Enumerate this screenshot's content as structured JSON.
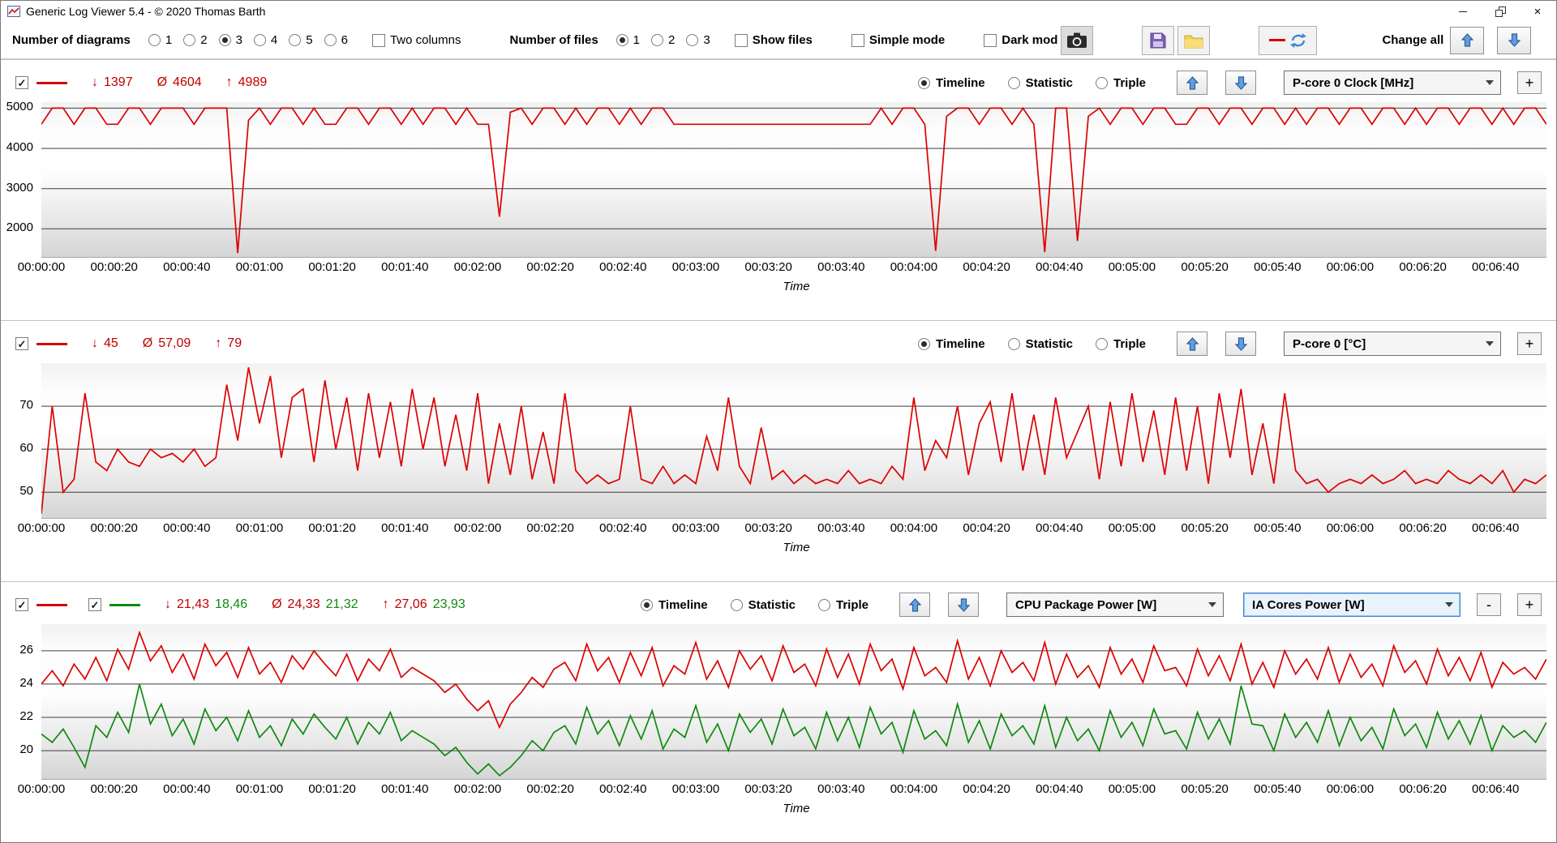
{
  "titlebar": {
    "title": "Generic Log Viewer 5.4 - © 2020 Thomas Barth",
    "close_glyph": "×"
  },
  "toolbar": {
    "diagrams_label": "Number of diagrams",
    "diagram_options": [
      "1",
      "2",
      "3",
      "4",
      "5",
      "6"
    ],
    "diagrams_selected": "3",
    "two_columns_label": "Two columns",
    "files_label": "Number of files",
    "file_options": [
      "1",
      "2",
      "3"
    ],
    "files_selected": "1",
    "show_files_label": "Show files",
    "simple_mode_label": "Simple mode",
    "dark_mode_label": "Dark mod",
    "change_all_label": "Change all"
  },
  "symbols": {
    "min": "↓",
    "avg": "Ø",
    "max": "↑"
  },
  "colors": {
    "series_red": "#dd0000",
    "series_green": "#0f8a0f",
    "stat_red": "#c00000",
    "stat_green": "#0f8a0f",
    "arrow_blue": "#5f9fe0"
  },
  "panels": [
    {
      "toggles": [
        {
          "color": "#d40000",
          "checked": true
        }
      ],
      "stats": {
        "min": [
          "1397"
        ],
        "avg": [
          "4604"
        ],
        "max": [
          "4989"
        ]
      },
      "view_options": [
        "Timeline",
        "Statistic",
        "Triple"
      ],
      "view_selected": "Timeline",
      "dropdowns": [
        "P-core 0 Clock [MHz]"
      ],
      "buttons": [
        "+"
      ]
    },
    {
      "toggles": [
        {
          "color": "#d40000",
          "checked": true
        }
      ],
      "stats": {
        "min": [
          "45"
        ],
        "avg": [
          "57,09"
        ],
        "max": [
          "79"
        ]
      },
      "view_options": [
        "Timeline",
        "Statistic",
        "Triple"
      ],
      "view_selected": "Timeline",
      "dropdowns": [
        "P-core 0 [°C]"
      ],
      "buttons": [
        "+"
      ]
    },
    {
      "toggles": [
        {
          "color": "#d40000",
          "checked": true
        },
        {
          "color": "#0f8a0f",
          "checked": true
        }
      ],
      "stats": {
        "min": [
          "21,43",
          "18,46"
        ],
        "avg": [
          "24,33",
          "21,32"
        ],
        "max": [
          "27,06",
          "23,93"
        ]
      },
      "view_options": [
        "Timeline",
        "Statistic",
        "Triple"
      ],
      "view_selected": "Timeline",
      "dropdowns": [
        "CPU Package Power [W]",
        "IA Cores Power [W]"
      ],
      "buttons": [
        "-",
        "+"
      ]
    }
  ],
  "chart_data": [
    {
      "type": "line",
      "title": "P-core 0 Clock [MHz]",
      "xlabel": "Time",
      "x_range": [
        0,
        414
      ],
      "x_tick_interval": 20,
      "x_ticks": [
        "00:00:00",
        "00:00:20",
        "00:00:40",
        "00:01:00",
        "00:01:20",
        "00:01:40",
        "00:02:00",
        "00:02:20",
        "00:02:40",
        "00:03:00",
        "00:03:20",
        "00:03:40",
        "00:04:00",
        "00:04:20",
        "00:04:40",
        "00:05:00",
        "00:05:20",
        "00:05:40",
        "00:06:00",
        "00:06:20",
        "00:06:40"
      ],
      "y_domain": [
        1300,
        5150
      ],
      "gridlines": [
        2000,
        3000,
        4000,
        5000
      ],
      "legend_position": "none",
      "grid": true,
      "series": [
        {
          "name": "P-core 0 Clock [MHz]",
          "color": "#dd0000",
          "x_step": 3,
          "values": [
            4600,
            5000,
            5000,
            4600,
            5000,
            5000,
            4600,
            4600,
            5000,
            5000,
            4600,
            5000,
            5000,
            5000,
            4600,
            5000,
            5000,
            5000,
            1397,
            4700,
            5000,
            4600,
            5000,
            5000,
            4600,
            5000,
            4600,
            4600,
            5000,
            5000,
            4600,
            5000,
            5000,
            4600,
            5000,
            4600,
            5000,
            5000,
            4600,
            5000,
            4600,
            4600,
            2300,
            4900,
            5000,
            4600,
            5000,
            5000,
            4600,
            5000,
            4600,
            5000,
            5000,
            4600,
            5000,
            4600,
            5000,
            5000,
            4600,
            4600,
            4600,
            4600,
            4600,
            4600,
            4600,
            4600,
            4600,
            4600,
            4600,
            4600,
            4600,
            4600,
            4600,
            4600,
            4600,
            4600,
            4600,
            5000,
            4600,
            5000,
            5000,
            4600,
            1450,
            4800,
            5000,
            5000,
            4600,
            5000,
            5000,
            4600,
            5000,
            4600,
            1420,
            5000,
            5000,
            1700,
            4800,
            5000,
            4600,
            5000,
            5000,
            4600,
            5000,
            5000,
            4600,
            4600,
            5000,
            5000,
            4600,
            5000,
            5000,
            4600,
            5000,
            5000,
            4600,
            5000,
            4600,
            5000,
            5000,
            4600,
            5000,
            5000,
            4600,
            5000,
            5000,
            4600,
            5000,
            4600,
            5000,
            5000,
            4600,
            5000,
            5000,
            4600,
            5000,
            4600,
            5000,
            5000,
            4600
          ]
        }
      ]
    },
    {
      "type": "line",
      "title": "P-core 0 [°C]",
      "xlabel": "Time",
      "x_range": [
        0,
        414
      ],
      "x_tick_interval": 20,
      "x_ticks": [
        "00:00:00",
        "00:00:20",
        "00:00:40",
        "00:01:00",
        "00:01:20",
        "00:01:40",
        "00:02:00",
        "00:02:20",
        "00:02:40",
        "00:03:00",
        "00:03:20",
        "00:03:40",
        "00:04:00",
        "00:04:20",
        "00:04:40",
        "00:05:00",
        "00:05:20",
        "00:05:40",
        "00:06:00",
        "00:06:20",
        "00:06:40"
      ],
      "y_domain": [
        44,
        80
      ],
      "gridlines": [
        50,
        60,
        70
      ],
      "legend_position": "none",
      "grid": true,
      "series": [
        {
          "name": "P-core 0 [°C]",
          "color": "#dd0000",
          "x_step": 3,
          "values": [
            45,
            70,
            50,
            53,
            73,
            57,
            55,
            60,
            57,
            56,
            60,
            58,
            59,
            57,
            60,
            56,
            58,
            75,
            62,
            79,
            66,
            77,
            58,
            72,
            74,
            57,
            76,
            60,
            72,
            55,
            73,
            58,
            71,
            56,
            74,
            60,
            72,
            56,
            68,
            55,
            73,
            52,
            66,
            54,
            70,
            53,
            64,
            52,
            73,
            55,
            52,
            54,
            52,
            53,
            70,
            53,
            52,
            56,
            52,
            54,
            52,
            63,
            55,
            72,
            56,
            52,
            65,
            53,
            55,
            52,
            54,
            52,
            53,
            52,
            55,
            52,
            53,
            52,
            56,
            53,
            72,
            55,
            62,
            58,
            70,
            54,
            66,
            71,
            57,
            73,
            55,
            68,
            54,
            72,
            58,
            64,
            70,
            53,
            71,
            56,
            73,
            57,
            69,
            54,
            72,
            55,
            70,
            52,
            73,
            58,
            74,
            54,
            66,
            52,
            73,
            55,
            52,
            53,
            50,
            52,
            53,
            52,
            54,
            52,
            53,
            55,
            52,
            53,
            52,
            55,
            53,
            52,
            54,
            52,
            55,
            50,
            53,
            52,
            54
          ]
        }
      ]
    },
    {
      "type": "line",
      "title": "CPU Package Power / IA Cores Power",
      "xlabel": "Time",
      "x_range": [
        0,
        414
      ],
      "x_tick_interval": 20,
      "x_ticks": [
        "00:00:00",
        "00:00:20",
        "00:00:40",
        "00:01:00",
        "00:01:20",
        "00:01:40",
        "00:02:00",
        "00:02:20",
        "00:02:40",
        "00:03:00",
        "00:03:20",
        "00:03:40",
        "00:04:00",
        "00:04:20",
        "00:04:40",
        "00:05:00",
        "00:05:20",
        "00:05:40",
        "00:06:00",
        "00:06:20",
        "00:06:40"
      ],
      "y_domain": [
        18.3,
        27.6
      ],
      "gridlines": [
        20,
        22,
        24,
        26
      ],
      "legend_position": "none",
      "grid": true,
      "series": [
        {
          "name": "CPU Package Power [W]",
          "color": "#dd0000",
          "x_step": 3,
          "values": [
            24.0,
            24.8,
            23.9,
            25.2,
            24.3,
            25.6,
            24.2,
            26.1,
            24.9,
            27.1,
            25.4,
            26.3,
            24.7,
            25.8,
            24.3,
            26.4,
            25.1,
            25.9,
            24.4,
            26.2,
            24.6,
            25.3,
            24.1,
            25.7,
            24.9,
            26.0,
            25.2,
            24.5,
            25.8,
            24.2,
            25.5,
            24.8,
            26.1,
            24.4,
            25.0,
            24.6,
            24.2,
            23.5,
            24.0,
            23.1,
            22.4,
            23.0,
            21.4,
            22.8,
            23.5,
            24.4,
            23.8,
            24.9,
            25.3,
            24.2,
            26.4,
            24.8,
            25.6,
            24.1,
            25.9,
            24.5,
            26.2,
            23.9,
            25.1,
            24.6,
            26.5,
            24.3,
            25.4,
            23.8,
            26.0,
            24.9,
            25.7,
            24.2,
            26.3,
            24.7,
            25.2,
            23.9,
            26.1,
            24.4,
            25.8,
            24.0,
            26.4,
            24.8,
            25.5,
            23.7,
            26.2,
            24.5,
            25.0,
            24.1,
            26.6,
            24.3,
            25.6,
            23.9,
            26.0,
            24.7,
            25.3,
            24.2,
            26.5,
            24.0,
            25.8,
            24.4,
            25.1,
            23.8,
            26.2,
            24.6,
            25.5,
            24.1,
            26.3,
            24.8,
            25.0,
            23.9,
            26.1,
            24.5,
            25.7,
            24.2,
            26.4,
            24.0,
            25.3,
            23.8,
            26.0,
            24.6,
            25.5,
            24.3,
            26.2,
            24.1,
            25.8,
            24.4,
            25.2,
            23.9,
            26.3,
            24.7,
            25.4,
            24.0,
            26.1,
            24.5,
            25.6,
            24.2,
            25.9,
            23.8,
            25.3,
            24.6,
            25.0,
            24.3,
            25.5
          ]
        },
        {
          "name": "IA Cores Power [W]",
          "color": "#0f8a0f",
          "x_step": 3,
          "values": [
            21.0,
            20.5,
            21.3,
            20.2,
            19.0,
            21.5,
            20.8,
            22.3,
            21.1,
            24.0,
            21.6,
            22.8,
            20.9,
            21.9,
            20.4,
            22.5,
            21.2,
            22.0,
            20.6,
            22.4,
            20.8,
            21.5,
            20.3,
            21.9,
            21.0,
            22.2,
            21.4,
            20.7,
            22.0,
            20.4,
            21.7,
            21.0,
            22.3,
            20.6,
            21.2,
            20.8,
            20.4,
            19.7,
            20.2,
            19.3,
            18.6,
            19.2,
            18.5,
            19.0,
            19.7,
            20.6,
            20.0,
            21.1,
            21.5,
            20.4,
            22.6,
            21.0,
            21.8,
            20.3,
            22.1,
            20.7,
            22.4,
            20.1,
            21.3,
            20.8,
            22.7,
            20.5,
            21.6,
            20.0,
            22.2,
            21.1,
            21.9,
            20.4,
            22.5,
            20.9,
            21.4,
            20.1,
            22.3,
            20.6,
            22.0,
            20.2,
            22.6,
            21.0,
            21.7,
            19.9,
            22.4,
            20.7,
            21.2,
            20.3,
            22.8,
            20.5,
            21.8,
            20.1,
            22.2,
            20.9,
            21.5,
            20.4,
            22.7,
            20.2,
            22.0,
            20.6,
            21.3,
            20.0,
            22.4,
            20.8,
            21.7,
            20.3,
            22.5,
            21.0,
            21.2,
            20.1,
            22.3,
            20.7,
            21.9,
            20.4,
            23.9,
            21.6,
            21.5,
            20.0,
            22.2,
            20.8,
            21.7,
            20.5,
            22.4,
            20.3,
            22.0,
            20.6,
            21.4,
            20.1,
            22.5,
            20.9,
            21.6,
            20.2,
            22.3,
            20.7,
            21.8,
            20.4,
            22.1,
            20.0,
            21.5,
            20.8,
            21.2,
            20.5,
            21.7
          ]
        }
      ]
    }
  ]
}
